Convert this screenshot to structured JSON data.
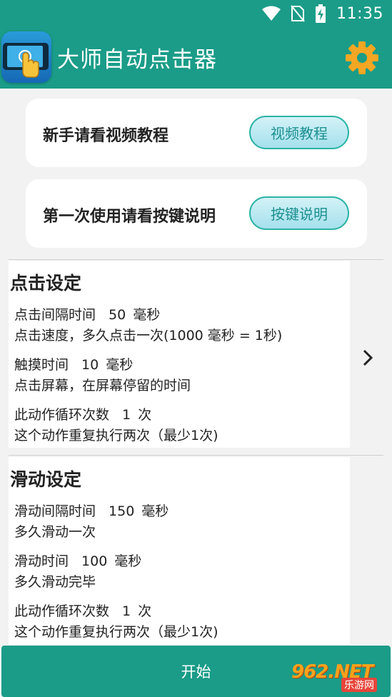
{
  "status_bar": {
    "time": "11:35",
    "icons": [
      "wifi-icon",
      "no-sim-icon",
      "battery-charging-icon"
    ]
  },
  "app_bar": {
    "title": "大师自动点击器",
    "logo_icon": "tap-phone-icon",
    "settings_icon": "gear-icon"
  },
  "tutorial_card": {
    "text": "新手请看视频教程",
    "button": "视频教程"
  },
  "keys_card": {
    "text": "第一次使用请看按键说明",
    "button": "按键说明"
  },
  "click_settings": {
    "title": "点击设定",
    "interval": {
      "label": "点击间隔时间",
      "value": "50",
      "unit": "毫秒",
      "desc": "点击速度，多久点击一次(1000 毫秒 = 1秒)"
    },
    "touch": {
      "label": "触摸时间",
      "value": "10",
      "unit": "毫秒",
      "desc": "点击屏幕，在屏幕停留的时间"
    },
    "loop": {
      "label": "此动作循环次数",
      "value": "1",
      "unit": "次",
      "desc": "这个动作重复执行两次（最少1次)"
    }
  },
  "swipe_settings": {
    "title": "滑动设定",
    "interval": {
      "label": "滑动间隔时间",
      "value": "150",
      "unit": "毫秒",
      "desc": "多久滑动一次"
    },
    "duration": {
      "label": "滑动时间",
      "value": "100",
      "unit": "毫秒",
      "desc": "多久滑动完毕"
    },
    "loop": {
      "label": "此动作循环次数",
      "value": "1",
      "unit": "次",
      "desc": "这个动作重复执行两次（最少1次)"
    }
  },
  "start_button": "开始",
  "watermark": {
    "top": "962.NET",
    "bottom": "乐游网"
  },
  "colors": {
    "primary": "#1a9c88",
    "gear": "#f5a623",
    "pill_border": "#2bb3a5",
    "pill_text": "#1b8f8f"
  }
}
